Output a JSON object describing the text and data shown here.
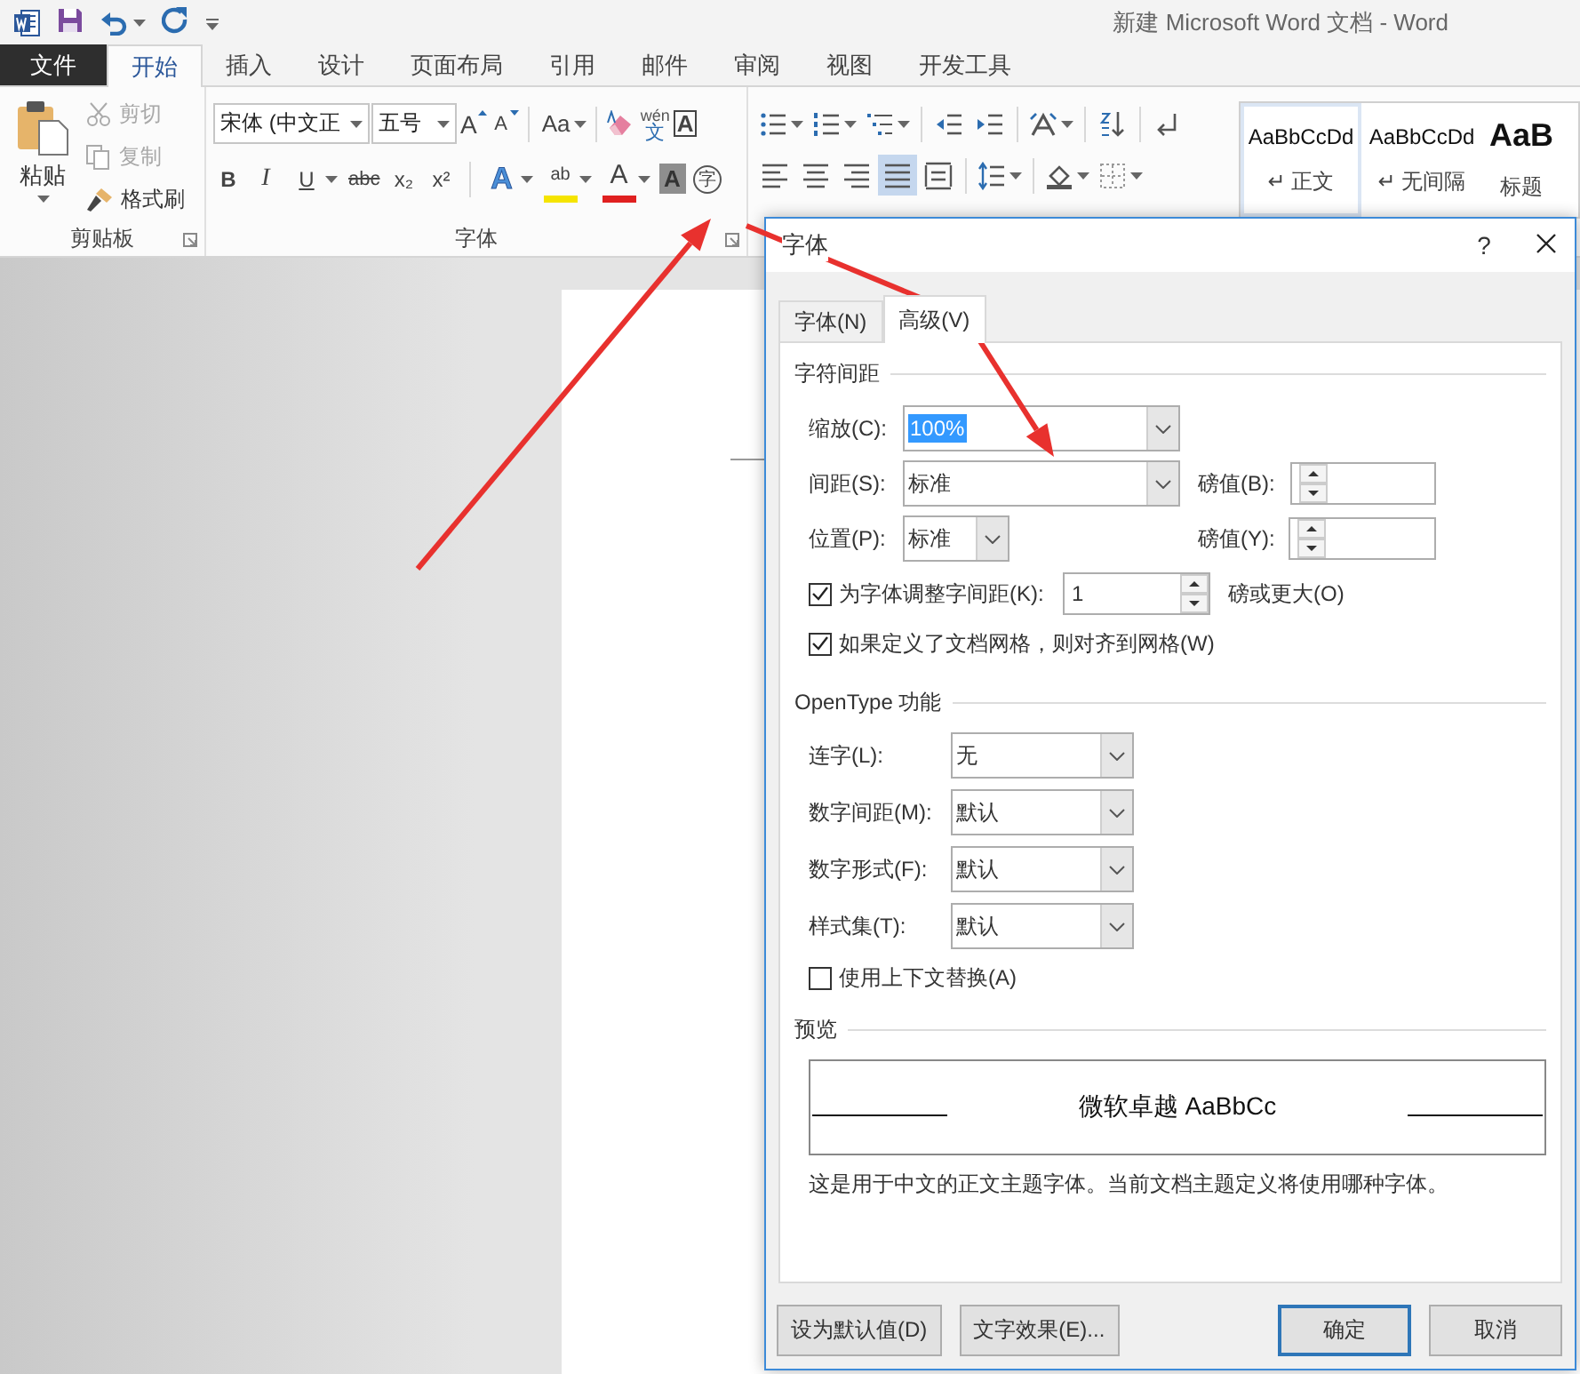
{
  "title_bar": {
    "title": "新建 Microsoft Word 文档 - Word"
  },
  "ribbon_tabs": [
    {
      "label": "文件",
      "kind": "file",
      "selected": false
    },
    {
      "label": "开始",
      "kind": "tab",
      "selected": true
    },
    {
      "label": "插入",
      "kind": "tab",
      "selected": false
    },
    {
      "label": "设计",
      "kind": "tab",
      "selected": false
    },
    {
      "label": "页面布局",
      "kind": "tab",
      "selected": false
    },
    {
      "label": "引用",
      "kind": "tab",
      "selected": false
    },
    {
      "label": "邮件",
      "kind": "tab",
      "selected": false
    },
    {
      "label": "审阅",
      "kind": "tab",
      "selected": false
    },
    {
      "label": "视图",
      "kind": "tab",
      "selected": false
    },
    {
      "label": "开发工具",
      "kind": "tab",
      "selected": false
    }
  ],
  "clipboard_group": {
    "label": "剪贴板",
    "paste": "粘贴",
    "items": [
      {
        "label": "剪切",
        "kind": "cut",
        "disabled": true
      },
      {
        "label": "复制",
        "kind": "copy",
        "disabled": true
      },
      {
        "label": "格式刷",
        "kind": "painter",
        "disabled": false
      }
    ]
  },
  "font_group": {
    "label": "字体",
    "font_name": "宋体 (中文正",
    "font_size": "五号",
    "row1": [
      {
        "kind": "grow",
        "label": "A"
      },
      {
        "kind": "shrink",
        "label": "A"
      },
      {
        "kind": "case",
        "label": "Aa"
      },
      {
        "kind": "clear"
      },
      {
        "kind": "phonetic",
        "label": "文",
        "ruby": "wén"
      },
      {
        "kind": "border",
        "label": "A"
      }
    ],
    "row2": [
      {
        "kind": "bold",
        "label": "B"
      },
      {
        "kind": "italic",
        "label": "I"
      },
      {
        "kind": "underline",
        "label": "U"
      },
      {
        "kind": "strike",
        "label": "abc"
      },
      {
        "kind": "subscript",
        "label": "x₂"
      },
      {
        "kind": "superscript",
        "label": "x²"
      },
      {
        "kind": "effects",
        "label": "A"
      },
      {
        "kind": "highlight",
        "label": "ab"
      },
      {
        "kind": "color",
        "label": "A"
      },
      {
        "kind": "shading",
        "label": "A"
      },
      {
        "kind": "enclose",
        "label": "字"
      }
    ]
  },
  "paragraph_group": {
    "align": [
      {
        "kind": "left",
        "selected": false
      },
      {
        "kind": "center",
        "selected": false
      },
      {
        "kind": "right",
        "selected": false
      },
      {
        "kind": "justify",
        "selected": true
      },
      {
        "kind": "distributed",
        "selected": false
      }
    ]
  },
  "styles_gallery": [
    {
      "sample": "AaBbCcDd",
      "mark": "↵",
      "label": "正文",
      "kind": "normal",
      "selected": true
    },
    {
      "sample": "AaBbCcDd",
      "mark": "↵",
      "label": "无间隔",
      "kind": "normal",
      "selected": false
    },
    {
      "sample": "AaB",
      "label": "标题",
      "kind": "heading",
      "selected": false
    }
  ],
  "dialog": {
    "title": "字体",
    "help": "?",
    "tabs": [
      {
        "label": "字体(N)",
        "selected": false
      },
      {
        "label": "高级(V)",
        "selected": true
      }
    ],
    "character_spacing": {
      "heading": "字符间距",
      "scale": {
        "label": "缩放(C):",
        "value": "100%",
        "value_selected": true
      },
      "spacing": {
        "label": "间距(S):",
        "value": "标准"
      },
      "spacing_by": {
        "label": "磅值(B):"
      },
      "position": {
        "label": "位置(P):",
        "value": "标准"
      },
      "position_by": {
        "label": "磅值(Y):"
      },
      "kerning": {
        "label": "为字体调整字间距(K):",
        "checked": true,
        "value": "1",
        "suffix": "磅或更大(O)"
      },
      "snap_to_grid": {
        "label": "如果定义了文档网格，则对齐到网格(W)",
        "checked": true
      }
    },
    "opentype": {
      "heading": "OpenType 功能",
      "fields": [
        {
          "label": "连字(L):",
          "value": "无"
        },
        {
          "label": "数字间距(M):",
          "value": "默认"
        },
        {
          "label": "数字形式(F):",
          "value": "默认"
        },
        {
          "label": "样式集(T):",
          "value": "默认"
        }
      ],
      "contextual": {
        "label": "使用上下文替换(A)",
        "checked": false
      }
    },
    "preview": {
      "heading": "预览",
      "sample": "微软卓越  AaBbCc",
      "note": "这是用于中文的正文主题字体。当前文档主题定义将使用哪种字体。"
    },
    "buttons": [
      {
        "label": "设为默认值(D)",
        "default": false
      },
      {
        "label": "文字效果(E)...",
        "default": false
      },
      {
        "label": "确定",
        "default": true
      },
      {
        "label": "取消",
        "default": false
      }
    ]
  }
}
